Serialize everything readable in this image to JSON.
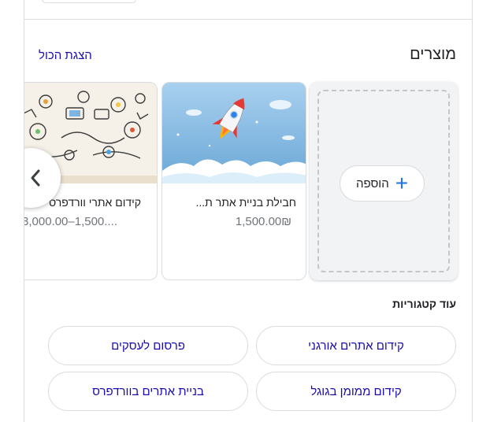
{
  "header": {
    "title": "מוצרים",
    "show_all": "הצגת הכול"
  },
  "add_card": {
    "label": "הוספה",
    "plus": "+"
  },
  "products": [
    {
      "name": "חבילת בניית אתר ת...",
      "price": "1,500.00₪"
    },
    {
      "name": "קידום אתרי וורדפרס",
      "price": "3,000.00–1,500...."
    }
  ],
  "more_categories": {
    "title": "עוד קטגוריות",
    "chips": [
      "קידום אתרים אורגני",
      "פרסום לעסקים",
      "קידום ממומן בגוגל",
      "בניית אתרים בוורדפרס"
    ]
  },
  "icons": {
    "scroll_left": "chevron-left-icon",
    "add": "plus-icon"
  },
  "colors": {
    "link": "#1a0dab",
    "accent": "#1a73e8",
    "muted": "#70757a",
    "border": "#dadce0"
  }
}
